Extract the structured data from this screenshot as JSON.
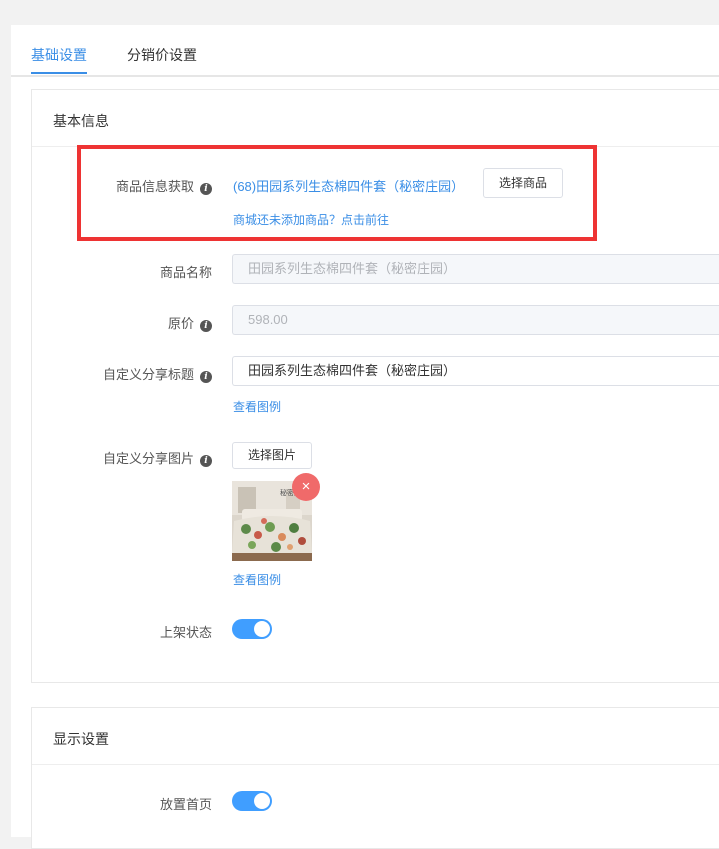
{
  "tabs": [
    {
      "label": "基础设置",
      "active": true
    },
    {
      "label": "分销价设置",
      "active": false
    }
  ],
  "basic_info": {
    "title": "基本信息",
    "product_fetch": {
      "label": "商品信息获取",
      "selected_product": "(68)田园系列生态棉四件套（秘密庄园）",
      "select_button": "选择商品",
      "hint_link": "商城还未添加商品？点击前往"
    },
    "product_name": {
      "label": "商品名称",
      "value": "田园系列生态棉四件套（秘密庄园）"
    },
    "original_price": {
      "label": "原价",
      "value": "598.00"
    },
    "share_title": {
      "label": "自定义分享标题",
      "value": "田园系列生态棉四件套（秘密庄园）",
      "example_link": "查看图例"
    },
    "share_image": {
      "label": "自定义分享图片",
      "select_button": "选择图片",
      "thumb_caption": "秘密庄",
      "remove_icon": "×",
      "example_link": "查看图例"
    },
    "listing_status": {
      "label": "上架状态",
      "enabled": true
    }
  },
  "display_settings": {
    "title": "显示设置",
    "homepage": {
      "label": "放置首页",
      "enabled": true
    }
  },
  "colors": {
    "accent": "#3a8ee6",
    "switch_on": "#409eff",
    "highlight_box": "#ee3333",
    "remove_button": "#f06a6a"
  },
  "icons": {
    "info": "info-icon",
    "remove": "close-icon"
  }
}
